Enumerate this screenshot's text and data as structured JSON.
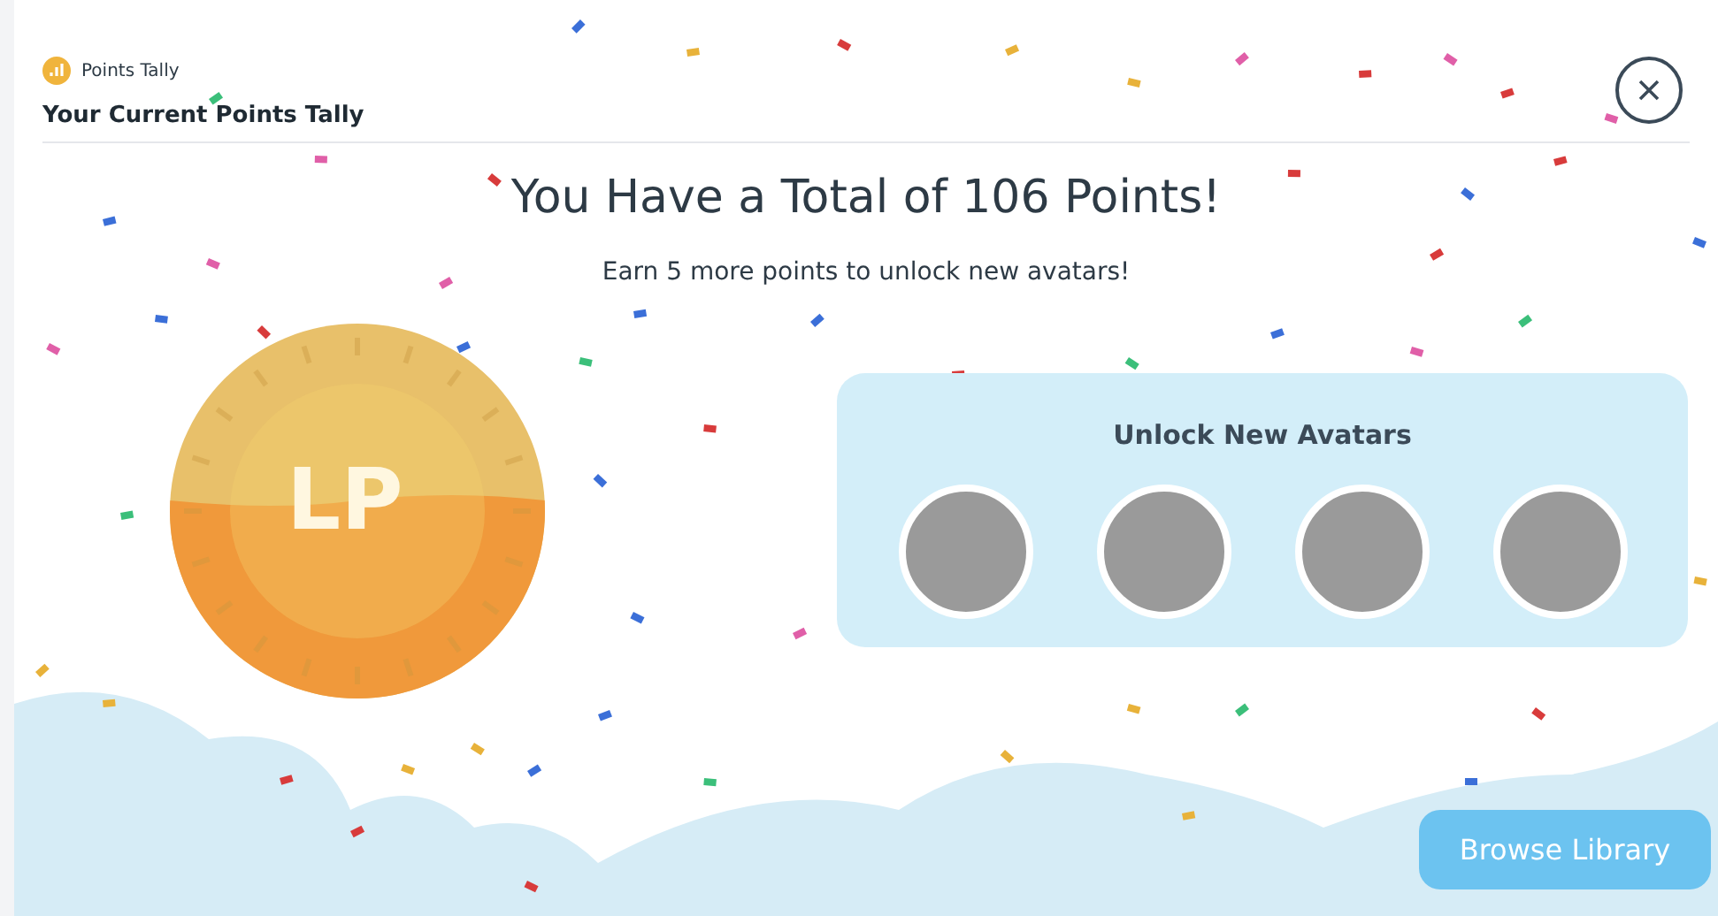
{
  "header": {
    "app_label": "Points Tally",
    "title": "Your Current Points Tally"
  },
  "headline": "You Have a Total of 106 Points!",
  "subtitle": "Earn 5 more points to unlock new avatars!",
  "coin": {
    "label": "LP"
  },
  "unlock_panel": {
    "title": "Unlock New Avatars"
  },
  "browse_button": "Browse Library"
}
